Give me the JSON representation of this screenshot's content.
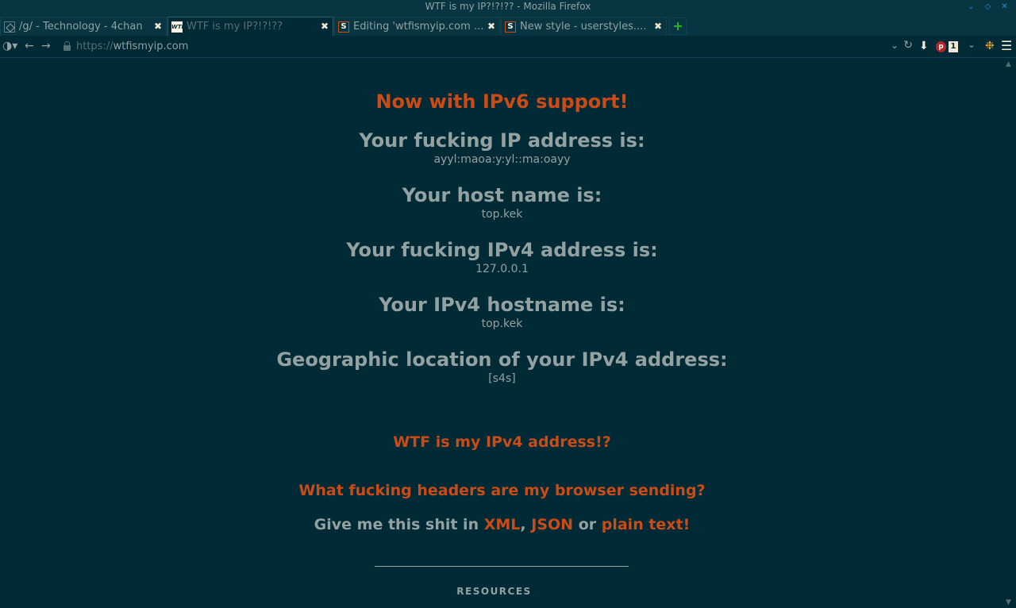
{
  "window": {
    "title": "WTF is my IP?!?!?? - Mozilla Firefox"
  },
  "tabs": [
    {
      "label": "/g/ - Technology - 4chan",
      "favicon": "4chan-clover-icon",
      "active": false
    },
    {
      "label": "WTF is my IP?!?!??",
      "favicon": "wtf-favicon",
      "active": true
    },
    {
      "label": "Editing 'wtfismyip.com ...",
      "favicon": "userstyles-s-icon",
      "active": false
    },
    {
      "label": "New style - userstyles....",
      "favicon": "userstyles-s-icon",
      "active": false
    }
  ],
  "urlbar": {
    "scheme": "https://",
    "host": "wtfismyip.com"
  },
  "page": {
    "banner": "Now with IPv6 support!",
    "sections": [
      {
        "heading": "Your fucking IP address is:",
        "value": "ayyl:maoa:y:yl::ma:oayy"
      },
      {
        "heading": "Your host name is:",
        "value": "top.kek"
      },
      {
        "heading": "Your fucking IPv4 address is:",
        "value": "127.0.0.1"
      },
      {
        "heading": "Your IPv4 hostname is:",
        "value": "top.kek"
      },
      {
        "heading": "Geographic location of your IPv4 address:",
        "value": "[s4s]"
      }
    ],
    "link_ipv4": "WTF is my IPv4 address!?",
    "link_headers": "What fucking headers are my browser sending?",
    "giveme_prefix": "Give me this shit in",
    "format_xml": "XML",
    "format_sep": ",",
    "format_json": "JSON",
    "format_or": "or",
    "format_plain": "plain text!",
    "resources": "RESOURCES"
  },
  "colors": {
    "background": "#002b36",
    "text": "#93a1a1",
    "accent": "#cb4b16"
  }
}
